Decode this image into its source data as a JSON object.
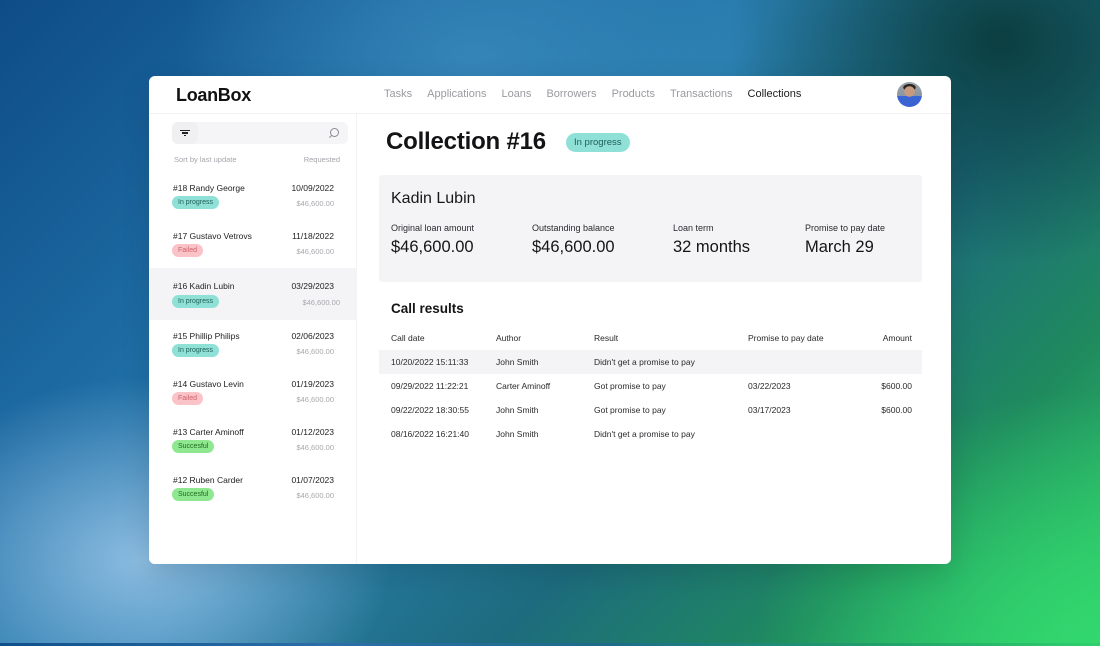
{
  "app": {
    "logo": "LoanBox",
    "avatar_icon": "user-avatar"
  },
  "nav": {
    "items": [
      {
        "label": "Tasks",
        "active": false
      },
      {
        "label": "Applications",
        "active": false
      },
      {
        "label": "Loans",
        "active": false
      },
      {
        "label": "Borrowers",
        "active": false
      },
      {
        "label": "Products",
        "active": false
      },
      {
        "label": "Transactions",
        "active": false
      },
      {
        "label": "Collections",
        "active": true
      }
    ]
  },
  "sidebar": {
    "search_placeholder": "",
    "sort_label": "Sort by last update",
    "requested_label": "Requested",
    "items": [
      {
        "name": "#18 Randy George",
        "date": "10/09/2022",
        "status": "In progress",
        "status_type": "progress",
        "amount": "$46,600.00",
        "selected": false
      },
      {
        "name": "#17 Gustavo Vetrovs",
        "date": "11/18/2022",
        "status": "Failed",
        "status_type": "failed",
        "amount": "$46,600.00",
        "selected": false
      },
      {
        "name": "#16 Kadin Lubin",
        "date": "03/29/2023",
        "status": "In progress",
        "status_type": "progress",
        "amount": "$46,600.00",
        "selected": true
      },
      {
        "name": "#15 Phillip Philips",
        "date": "02/06/2023",
        "status": "In progress",
        "status_type": "progress",
        "amount": "$46,600.00",
        "selected": false
      },
      {
        "name": "#14 Gustavo Levin",
        "date": "01/19/2023",
        "status": "Failed",
        "status_type": "failed",
        "amount": "$46,600.00",
        "selected": false
      },
      {
        "name": "#13 Carter Aminoff",
        "date": "01/12/2023",
        "status": "Succesful",
        "status_type": "success",
        "amount": "$46,600.00",
        "selected": false
      },
      {
        "name": "#12 Ruben Carder",
        "date": "01/07/2023",
        "status": "Succesful",
        "status_type": "success",
        "amount": "$46,600.00",
        "selected": false
      }
    ]
  },
  "main": {
    "title": "Collection #16",
    "status": "In progress",
    "borrower": "Kadin Lubin",
    "metrics": [
      {
        "label": "Original loan amount",
        "value": "$46,600.00"
      },
      {
        "label": "Outstanding balance",
        "value": "$46,600.00"
      },
      {
        "label": "Loan term",
        "value": "32 months"
      },
      {
        "label": "Promise to pay date",
        "value": "March 29"
      }
    ],
    "call_results": {
      "title": "Call results",
      "columns": [
        "Call date",
        "Author",
        "Result",
        "Promise to pay date",
        "Amount"
      ],
      "rows": [
        {
          "date": "10/20/2022 15:11:33",
          "author": "John Smith",
          "result": "Didn't get a promise to pay",
          "promise_date": "",
          "amount": ""
        },
        {
          "date": "09/29/2022 11:22:21",
          "author": "Carter Aminoff",
          "result": "Got promise to pay",
          "promise_date": "03/22/2023",
          "amount": "$600.00"
        },
        {
          "date": "09/22/2022 18:30:55",
          "author": "John Smith",
          "result": "Got promise to pay",
          "promise_date": "03/17/2023",
          "amount": "$600.00"
        },
        {
          "date": "08/16/2022 16:21:40",
          "author": "John Smith",
          "result": "Didn't get a promise to pay",
          "promise_date": "",
          "amount": ""
        }
      ]
    }
  }
}
